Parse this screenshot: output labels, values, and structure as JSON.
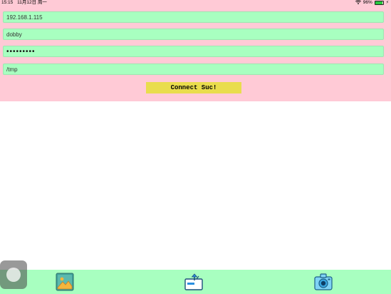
{
  "status_bar": {
    "time": "15:15",
    "date": "11月12日 周一",
    "battery_percent": "96%",
    "battery_level": 0.96
  },
  "form": {
    "host": "192.168.1.115",
    "username": "dobby",
    "password": "123456789",
    "path": "/tmp"
  },
  "connect_button": {
    "label": "Connect Suc!"
  },
  "tabs": [
    {
      "icon": "photo-icon"
    },
    {
      "icon": "upload-icon"
    },
    {
      "icon": "camera-icon"
    }
  ],
  "colors": {
    "panel": "#ffcad6",
    "field": "#a8ffc0",
    "button": "#e9dd4d",
    "tab_bar": "#a8ffc0"
  }
}
